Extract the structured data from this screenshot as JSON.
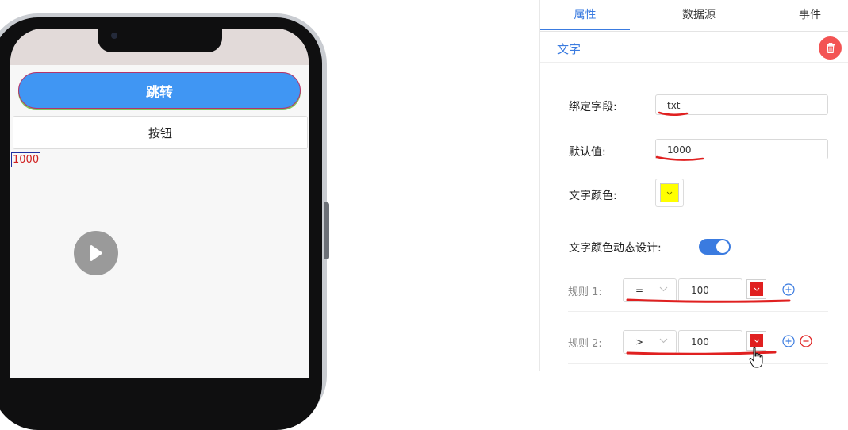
{
  "preview": {
    "jump_button_label": "跳转",
    "button_label": "按钮",
    "text_value": "1000"
  },
  "panel": {
    "tabs": [
      {
        "label": "属性",
        "active": true
      },
      {
        "label": "数据源",
        "active": false
      },
      {
        "label": "事件",
        "active": false
      }
    ],
    "section_title": "文字",
    "bind_field": {
      "label": "绑定字段:",
      "value": "txt"
    },
    "default_value": {
      "label": "默认值:",
      "value": "1000"
    },
    "text_color": {
      "label": "文字颜色:",
      "color": "#ffff00"
    },
    "dynamic_color": {
      "label": "文字颜色动态设计:",
      "enabled": true
    },
    "rules": [
      {
        "label": "规则 1:",
        "operator": "=",
        "value": "100",
        "color": "#e02020"
      },
      {
        "label": "规则 2:",
        "operator": ">",
        "value": "100",
        "color": "#e02020"
      }
    ]
  },
  "colors": {
    "accent": "#3a7be0",
    "delete": "#f35454",
    "annotation": "#e02020"
  },
  "icons": [
    "trash-icon",
    "play-icon",
    "chevron-down-icon",
    "plus-circle-icon",
    "minus-circle-icon",
    "hand-cursor-icon"
  ]
}
